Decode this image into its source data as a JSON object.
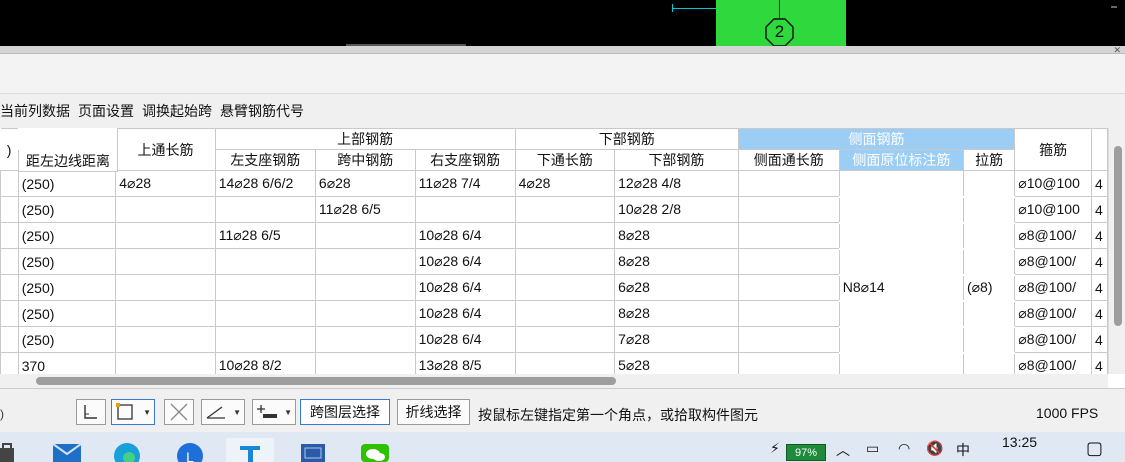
{
  "canvas": {
    "grid_number": "2"
  },
  "menu": {
    "items": [
      "当前列数据",
      "页面设置",
      "调换起始跨",
      "悬臂钢筋代号"
    ]
  },
  "table": {
    "group_headers": {
      "left_cut": ")",
      "top_through": "上通长筋",
      "top_rebar": "上部钢筋",
      "bottom_rebar": "下部钢筋",
      "side_rebar": "侧面钢筋",
      "stirrup": "箍筋"
    },
    "sub_headers": {
      "left_edge_distance": "距左边线距离",
      "left_support": "左支座钢筋",
      "mid_span": "跨中钢筋",
      "right_support": "右支座钢筋",
      "bottom_through": "下通长筋",
      "bottom_rebar": "下部钢筋",
      "side_through": "侧面通长筋",
      "side_original": "侧面原位标注筋",
      "tie_bar": "拉筋"
    },
    "rows": [
      {
        "dist": "(250)",
        "top_through": "4⌀28",
        "left_support": "14⌀28 6/6/2",
        "mid_span": "6⌀28",
        "right_support": "11⌀28 7/4",
        "bottom_through": "4⌀28",
        "bottom_rebar": "12⌀28 4/8",
        "side_through": "",
        "side_original": "",
        "tie": "",
        "stirrup": "⌀10@100",
        "extra": "4"
      },
      {
        "dist": "(250)",
        "top_through": "",
        "left_support": "",
        "mid_span": "11⌀28 6/5",
        "right_support": "",
        "bottom_through": "",
        "bottom_rebar": "10⌀28 2/8",
        "side_through": "",
        "side_original": "",
        "tie": "",
        "stirrup": "⌀10@100",
        "extra": "4"
      },
      {
        "dist": "(250)",
        "top_through": "",
        "left_support": "11⌀28 6/5",
        "mid_span": "",
        "right_support": "10⌀28 6/4",
        "bottom_through": "",
        "bottom_rebar": "8⌀28",
        "side_through": "",
        "side_original": "",
        "tie": "",
        "stirrup": "⌀8@100/",
        "extra": "4"
      },
      {
        "dist": "(250)",
        "top_through": "",
        "left_support": "",
        "mid_span": "",
        "right_support": "10⌀28 6/4",
        "bottom_through": "",
        "bottom_rebar": "8⌀28",
        "side_through": "",
        "side_original": "",
        "tie": "",
        "stirrup": "⌀8@100/",
        "extra": "4"
      },
      {
        "dist": "(250)",
        "top_through": "",
        "left_support": "",
        "mid_span": "",
        "right_support": "10⌀28 6/4",
        "bottom_through": "",
        "bottom_rebar": "6⌀28",
        "side_through": "",
        "side_original": "N8⌀14",
        "tie": "(⌀8)",
        "stirrup": "⌀8@100/",
        "extra": "4"
      },
      {
        "dist": "(250)",
        "top_through": "",
        "left_support": "",
        "mid_span": "",
        "right_support": "10⌀28 6/4",
        "bottom_through": "",
        "bottom_rebar": "8⌀28",
        "side_through": "",
        "side_original": "",
        "tie": "",
        "stirrup": "⌀8@100/",
        "extra": "4"
      },
      {
        "dist": "(250)",
        "top_through": "",
        "left_support": "",
        "mid_span": "",
        "right_support": "10⌀28 6/4",
        "bottom_through": "",
        "bottom_rebar": "7⌀28",
        "side_through": "",
        "side_original": "",
        "tie": "",
        "stirrup": "⌀8@100/",
        "extra": "4"
      },
      {
        "dist": "370",
        "top_through": "",
        "left_support": "10⌀28 8/2",
        "mid_span": "",
        "right_support": "13⌀28 8/5",
        "bottom_through": "",
        "bottom_rebar": "5⌀28",
        "side_through": "",
        "side_original": "",
        "tie": "",
        "stirrup": "⌀8@100/",
        "extra": "4"
      }
    ]
  },
  "toolbar": {
    "cross_layer_select": "跨图层选择",
    "polyline_select": "折线选择",
    "status_message": "按鼠标左键指定第一个角点，或拾取构件图元",
    "fps": "1000 FPS",
    "left_indicator": ")"
  },
  "taskbar": {
    "battery": "97%",
    "time": "13:25",
    "ime": "中",
    "colors": {
      "green": "#1e8a3a",
      "accent": "#9ccef5"
    }
  }
}
